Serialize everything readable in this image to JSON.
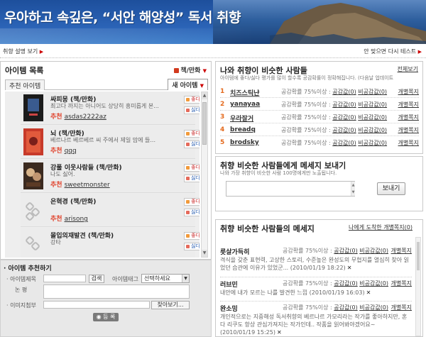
{
  "banner": {
    "title": "우아하고 속깊은, “서안 해양성” 독서 취향"
  },
  "topline": {
    "left_link": "취향 설명 보기",
    "right_link": "안 맞으면 다시 테스트"
  },
  "item_list": {
    "title": "아이템 목록",
    "category": "책/만화",
    "tab_recommended": "추천 아이템",
    "tab_new": "새 아이템",
    "vote_up": "좋다",
    "vote_down": "싫다",
    "rec_label": "추천",
    "items": [
      {
        "title": "싸피몽 (책/만화)",
        "desc": "최고다 까지는 아니어도 상당히 흥미롭게 본...",
        "recommender": "asdas2222az"
      },
      {
        "title": "뇌 (책/만화)",
        "desc": "베르나르 베르베르 씨 주에서 제일 맘에 들...",
        "recommender": "qqq"
      },
      {
        "title": "강풀 이웃사람들 (책/만화)",
        "desc": "나도 싫어.",
        "recommender": "sweetmonster"
      },
      {
        "title": "은혁경 (책/만화)",
        "desc": "",
        "recommender": "arisong"
      },
      {
        "title": "몰입의재발견 (책/만화)",
        "desc": "강타",
        "recommender": ""
      }
    ]
  },
  "recommend_form": {
    "title": "· 아이템 추천하기",
    "item_name_label": "· 아이템제목",
    "search_button": "검색",
    "tag_label": "아이템태그",
    "tag_select": "선택하세요",
    "review_label": "논      평",
    "image_label": "· 이미지첨부",
    "browse_button": "찾아보기...",
    "submit_button": "등 록"
  },
  "similar": {
    "title": "나와 취향이 비슷한 사람들",
    "more_link": "전체보기",
    "subtitle": "아이템에 좋다/싫다 평가를 많이 할수록 공감확률이 정확해집니다. (다음날 업데이트",
    "stat_prefix": "공감확률 75%이상 :",
    "agree": "공감",
    "agree_suffix": "값(0)",
    "disagree": "비공감",
    "disagree_suffix": "값(0)",
    "pm_label": "개별쪽지",
    "users": [
      {
        "rank": "1",
        "name": "치즈스틱냔"
      },
      {
        "rank": "2",
        "name": "yanayaa"
      },
      {
        "rank": "3",
        "name": "우라잘거"
      },
      {
        "rank": "4",
        "name": "breadq"
      },
      {
        "rank": "5",
        "name": "brodsky"
      }
    ]
  },
  "send_message": {
    "title": "취향 비슷한 사람들에게 메세지 보내기",
    "subtitle": "나와 가장 취향이 비슷한 사람 100명에게만 노출됩니다.",
    "send_button": "보내기"
  },
  "messages": {
    "title": "취향 비슷한 사람들의 메세지",
    "inbox_link": "나에게 도착한 개별쪽지(0)",
    "stat_prefix": "공감확률 75%이상 :",
    "agree": "공감값(0)",
    "disagree": "비공감값(0)",
    "pm_label": "개별쪽지",
    "items": [
      {
        "name": "릇살가득히",
        "body": "격식을 갖춘 표현력, 고상한 스토리, 수준높은 완성도의 무협지를 열심히 찾아 읽었던 습관에 이유가 있었군... (2010/01/19 18:22)"
      },
      {
        "name": "러브민",
        "body": "내안에 내가 모르는 나를 발견한 느낌 (2010/01/19 16:03)"
      },
      {
        "name": "완소밍",
        "body": "개인적으로는 지중해성 독서취향의 베르나르 가모리라는 작가를 좋아하지만, 혼다 리쿠도 항상 관심가져지는 작가인데.. 작품을 읽어봐야겠어요~ (2010/01/19 15:25)"
      }
    ]
  }
}
